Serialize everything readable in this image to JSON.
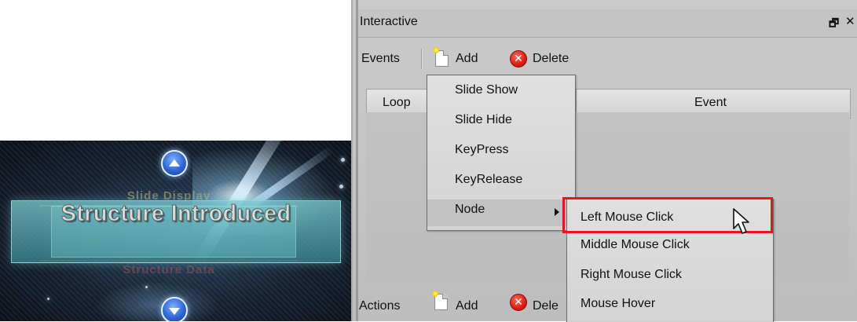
{
  "preview": {
    "slide_title": "Structure Introduced",
    "ghost_top": "Slide Display",
    "ghost_bottom": "Structure Data",
    "nav_up_icon": "up-arrow-icon",
    "nav_down_icon": "down-arrow-icon"
  },
  "panel": {
    "title": "Interactive",
    "window_controls": {
      "restore_icon": "restore-icon",
      "close_icon": "close-icon",
      "restore_glyph": "🗗",
      "close_glyph": "✕"
    }
  },
  "events_toolbar": {
    "label": "Events",
    "add_label": "Add",
    "delete_label": "Delete",
    "add_icon": "new-file-icon",
    "delete_icon": "delete-icon",
    "delete_glyph": "✕"
  },
  "actions_toolbar": {
    "label": "Actions",
    "add_label": "Add",
    "delete_label": "Dele",
    "add_icon": "new-file-icon",
    "delete_icon": "delete-icon",
    "delete_glyph": "✕"
  },
  "table": {
    "columns": [
      "Loop",
      "Event"
    ]
  },
  "event_menu": {
    "items": [
      "Slide Show",
      "Slide Hide",
      "KeyPress",
      "KeyRelease",
      "Node"
    ],
    "hover_index": 4
  },
  "node_submenu": {
    "items": [
      "Left Mouse Click",
      "Middle Mouse Click",
      "Right Mouse Click",
      "Mouse Hover"
    ],
    "highlighted_index": 0
  },
  "colors": {
    "highlight_border": "#e0191f",
    "panel_background": "#c6c6c6",
    "menu_background": "#d9d9d9",
    "delete_icon_red": "#d81f12"
  }
}
